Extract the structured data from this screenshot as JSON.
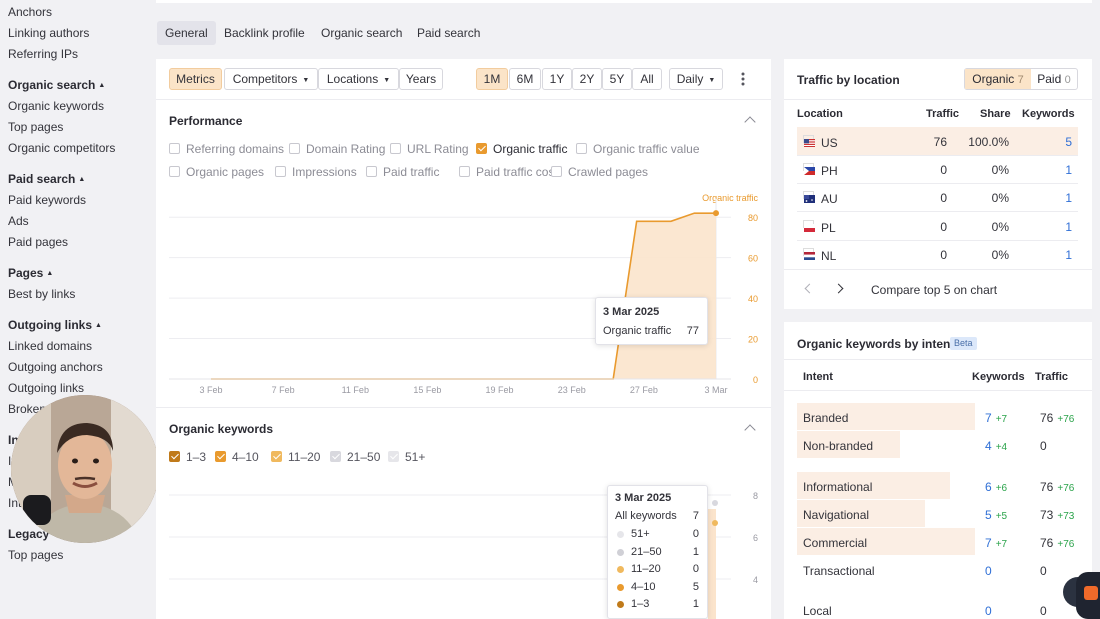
{
  "sidebar": {
    "items_top": [
      "Anchors",
      "Linking authors",
      "Referring IPs"
    ],
    "organic_search": {
      "heading": "Organic search",
      "items": [
        "Organic keywords",
        "Top pages",
        "Organic competitors"
      ]
    },
    "paid_search": {
      "heading": "Paid search",
      "items": [
        "Paid keywords",
        "Ads",
        "Paid pages"
      ]
    },
    "pages": {
      "heading": "Pages",
      "items": [
        "Best by links"
      ]
    },
    "outgoing_links": {
      "heading": "Outgoing links",
      "items": [
        "Linked domains",
        "Outgoing anchors",
        "Outgoing links",
        "Broken"
      ]
    },
    "partial_heading": "In",
    "partial_items": [
      "In",
      "M",
      "Int"
    ],
    "legacy": {
      "heading": "Legacy",
      "items": [
        "Top pages"
      ]
    }
  },
  "main_tabs": [
    "General",
    "Backlink profile",
    "Organic search",
    "Paid search"
  ],
  "toolbar": {
    "metrics": "Metrics",
    "competitors": "Competitors",
    "locations": "Locations",
    "years": "Years",
    "ranges": [
      "1M",
      "6M",
      "1Y",
      "2Y",
      "5Y",
      "All"
    ],
    "interval": "Daily"
  },
  "performance": {
    "title": "Performance",
    "checkboxes_row1": [
      {
        "label": "Referring domains",
        "checked": false
      },
      {
        "label": "Domain Rating",
        "checked": false
      },
      {
        "label": "URL Rating",
        "checked": false
      },
      {
        "label": "Organic traffic",
        "checked": true
      },
      {
        "label": "Organic traffic value",
        "checked": false
      }
    ],
    "checkboxes_row2": [
      {
        "label": "Organic pages",
        "checked": false
      },
      {
        "label": "Impressions",
        "checked": false
      },
      {
        "label": "Paid traffic",
        "checked": false
      },
      {
        "label": "Paid traffic cost",
        "checked": false
      },
      {
        "label": "Crawled pages",
        "checked": false
      }
    ],
    "tooltip": {
      "date": "3 Mar 2025",
      "label": "Organic traffic",
      "value": "77"
    }
  },
  "organic_keywords": {
    "title": "Organic keywords",
    "legend": [
      {
        "label": "1–3",
        "color": "#c07a1a",
        "checked": true
      },
      {
        "label": "4–10",
        "color": "#e99a2e",
        "checked": true
      },
      {
        "label": "11–20",
        "color": "#f0b95e",
        "checked": true
      },
      {
        "label": "21–50",
        "color": "#d8d8de",
        "checked": true
      },
      {
        "label": "51+",
        "color": "#e6e6ea",
        "checked": true
      }
    ],
    "tooltip": {
      "date": "3 Mar 2025",
      "total_label": "All keywords",
      "total_value": "7",
      "rows": [
        {
          "label": "51+",
          "value": "0",
          "color": "#e6e6ea"
        },
        {
          "label": "21–50",
          "value": "1",
          "color": "#d0d0d6"
        },
        {
          "label": "11–20",
          "value": "0",
          "color": "#f0b95e"
        },
        {
          "label": "4–10",
          "value": "5",
          "color": "#e99a2e"
        },
        {
          "label": "1–3",
          "value": "1",
          "color": "#c07a1a"
        }
      ]
    },
    "y_ticks": [
      "8",
      "6",
      "4"
    ]
  },
  "chart_data": {
    "type": "area",
    "series": [
      {
        "name": "Organic traffic",
        "color": "#e99a2e",
        "x": [
          "1 Mar 2025",
          "25 Feb 2025",
          "26 Feb 2025",
          "27 Feb 2025",
          "28 Feb 2025",
          "1 Mar 2025",
          "2 Mar 2025",
          "3 Mar 2025"
        ],
        "values": [
          0,
          0,
          0,
          78,
          78,
          78,
          82,
          82
        ]
      }
    ],
    "x_ticks": [
      "3 Feb",
      "7 Feb",
      "11 Feb",
      "15 Feb",
      "19 Feb",
      "23 Feb",
      "27 Feb",
      "3 Mar"
    ],
    "y_ticks": [
      "0",
      "20",
      "40",
      "60",
      "80"
    ],
    "ylim": [
      0,
      90
    ],
    "series_label": "Organic traffic"
  },
  "traffic_by_location": {
    "title": "Traffic by location",
    "toggle": {
      "organic_label": "Organic",
      "organic_count": "7",
      "paid_label": "Paid",
      "paid_count": "0"
    },
    "headers": {
      "location": "Location",
      "traffic": "Traffic",
      "share": "Share",
      "keywords": "Keywords"
    },
    "rows": [
      {
        "country": "US",
        "traffic": "76",
        "share": "100.0%",
        "keywords": "5"
      },
      {
        "country": "PH",
        "traffic": "0",
        "share": "0%",
        "keywords": "1"
      },
      {
        "country": "AU",
        "traffic": "0",
        "share": "0%",
        "keywords": "1"
      },
      {
        "country": "PL",
        "traffic": "0",
        "share": "0%",
        "keywords": "1"
      },
      {
        "country": "NL",
        "traffic": "0",
        "share": "0%",
        "keywords": "1"
      }
    ],
    "compare": "Compare top 5 on chart"
  },
  "keywords_by_intent": {
    "title": "Organic keywords by intent",
    "badge": "Beta",
    "headers": {
      "intent": "Intent",
      "keywords": "Keywords",
      "traffic": "Traffic"
    },
    "rows": [
      {
        "intent": "Branded",
        "keywords": "7",
        "kw_delta": "+7",
        "traffic": "76",
        "tr_delta": "+76"
      },
      {
        "intent": "Non-branded",
        "keywords": "4",
        "kw_delta": "+4",
        "traffic": "0",
        "tr_delta": ""
      },
      {
        "intent": "Informational",
        "keywords": "6",
        "kw_delta": "+6",
        "traffic": "76",
        "tr_delta": "+76"
      },
      {
        "intent": "Navigational",
        "keywords": "5",
        "kw_delta": "+5",
        "traffic": "73",
        "tr_delta": "+73"
      },
      {
        "intent": "Commercial",
        "keywords": "7",
        "kw_delta": "+7",
        "traffic": "76",
        "tr_delta": "+76"
      },
      {
        "intent": "Transactional",
        "keywords": "0",
        "kw_delta": "",
        "traffic": "0",
        "tr_delta": ""
      },
      {
        "intent": "Local",
        "keywords": "0",
        "kw_delta": "",
        "traffic": "0",
        "tr_delta": ""
      }
    ]
  }
}
